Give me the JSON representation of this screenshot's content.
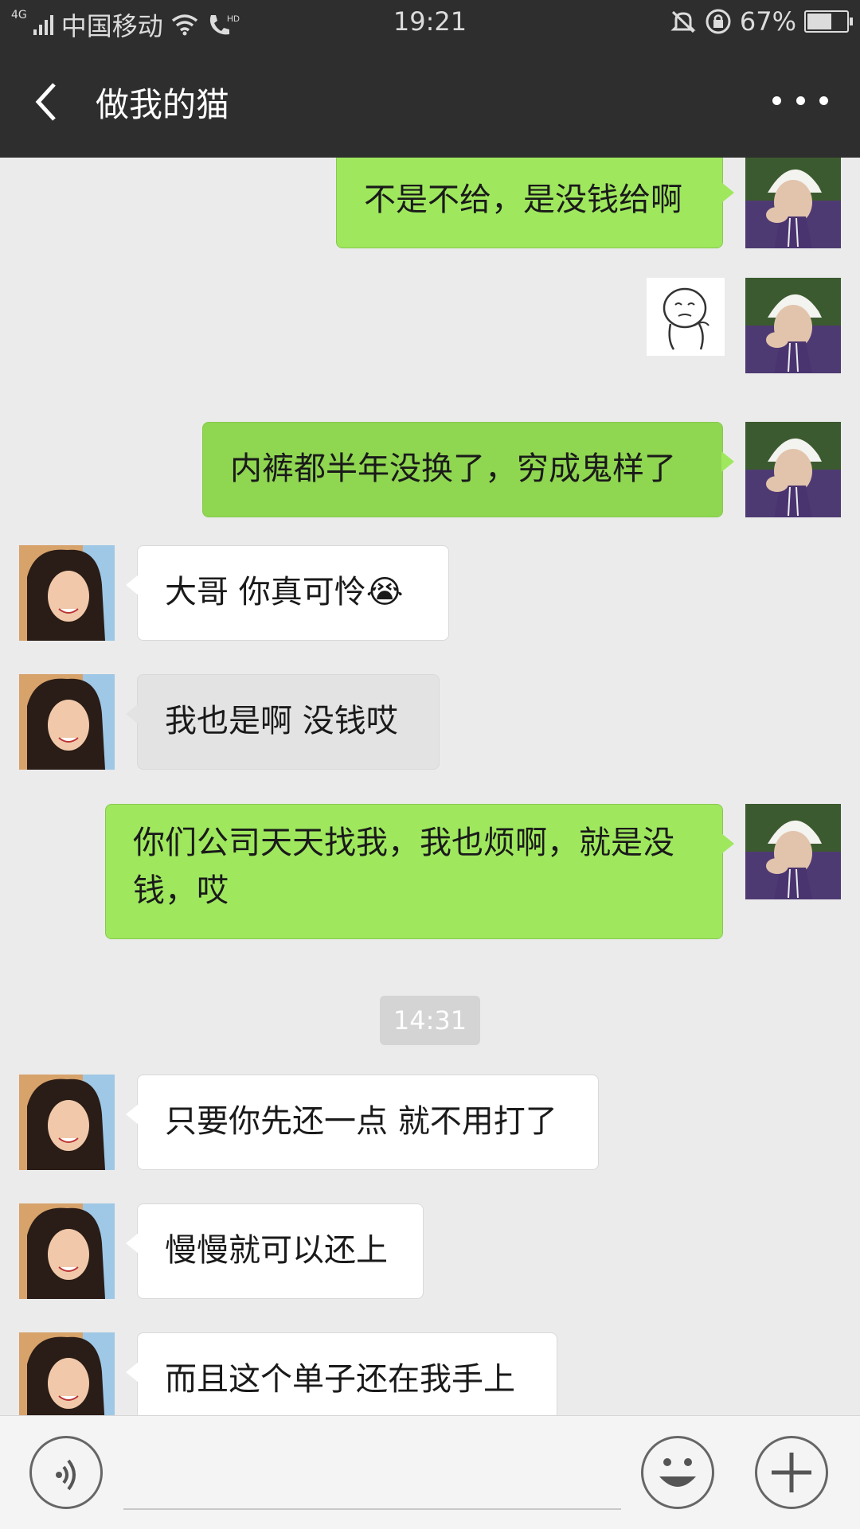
{
  "status_bar": {
    "network_type": "4G",
    "carrier": "中国移动",
    "time": "19:21",
    "battery_percent": "67%",
    "battery_level": 0.67
  },
  "header": {
    "title": "做我的猫",
    "back_icon": "chevron-left-icon",
    "more_icon": "more-dots-icon"
  },
  "messages": [
    {
      "sender": "me",
      "type": "text",
      "text": "不是不给，是没钱给啊"
    },
    {
      "sender": "me",
      "type": "sticker",
      "sticker": "crying-face-meme"
    },
    {
      "sender": "me",
      "type": "text",
      "text": "内裤都半年没换了，穷成鬼样了"
    },
    {
      "sender": "them",
      "type": "text",
      "text": "大哥  你真可怜",
      "emoji": "😭"
    },
    {
      "sender": "them",
      "type": "text",
      "text": "我也是啊  没钱哎"
    },
    {
      "sender": "me",
      "type": "text",
      "line1": "你们公司天天找我，我也烦啊，就是没",
      "line2": "钱，哎"
    },
    {
      "type": "timestamp",
      "text": "14:31"
    },
    {
      "sender": "them",
      "type": "text",
      "text": "只要你先还一点 就不用打了"
    },
    {
      "sender": "them",
      "type": "text",
      "text": "慢慢就可以还上"
    },
    {
      "sender": "them",
      "type": "text",
      "text": "而且这个单子还在我手上"
    }
  ],
  "input_bar": {
    "voice_icon": "voice-icon",
    "emoji_icon": "smiley-icon",
    "add_icon": "plus-icon",
    "text_value": ""
  },
  "colors": {
    "header_bg": "#2e2e2e",
    "chat_bg": "#ebebeb",
    "my_bubble": "#9fe85e",
    "their_bubble": "#ffffff"
  }
}
